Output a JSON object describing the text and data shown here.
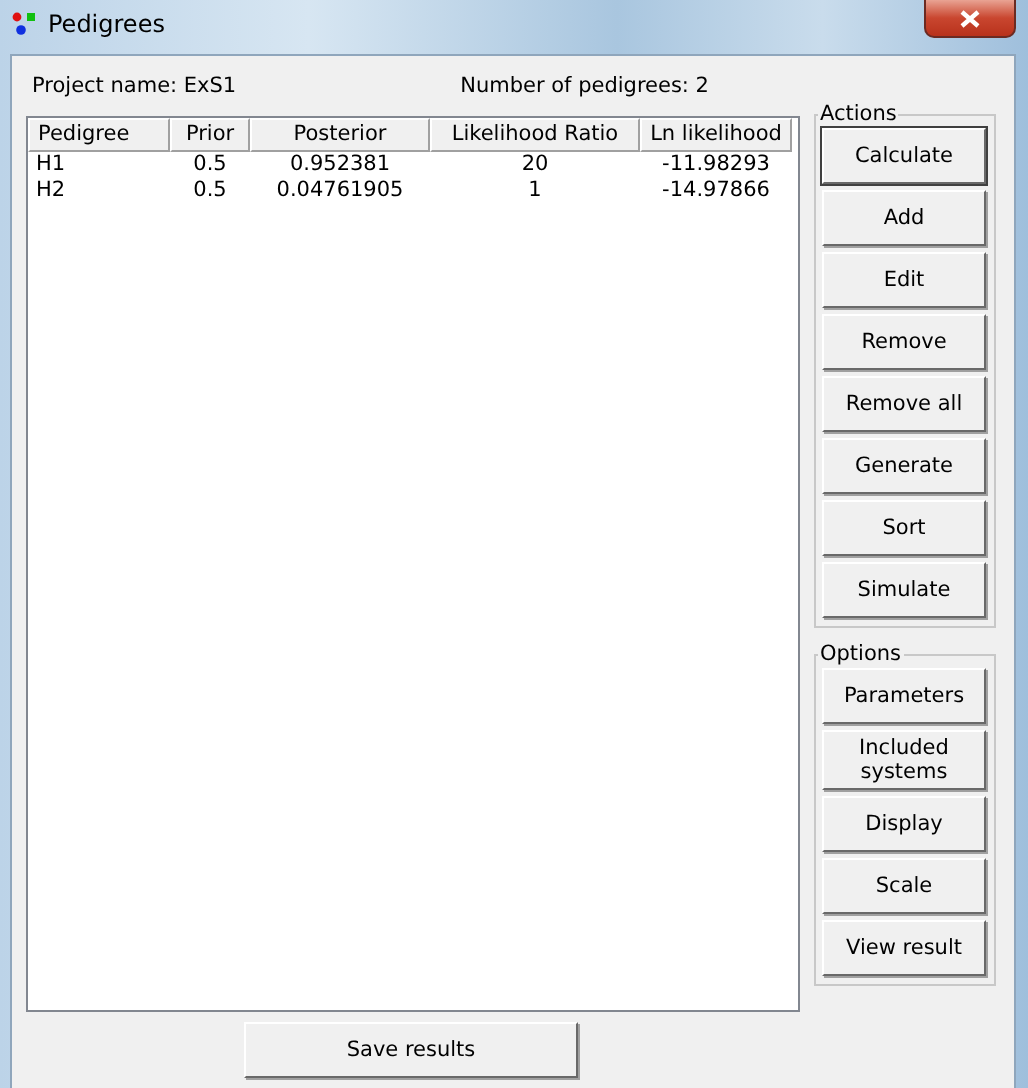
{
  "window": {
    "title": "Pedigrees"
  },
  "project_name": "Project name: ExS1",
  "pedigree_count": "Number of pedigrees: 2",
  "table": {
    "columns": [
      "Pedigree",
      "Prior",
      "Posterior",
      "Likelihood Ratio",
      "Ln likelihood"
    ],
    "rows": [
      [
        "H1",
        "0.5",
        "0.952381",
        "20",
        "-11.98293"
      ],
      [
        "H2",
        "0.5",
        "0.04761905",
        "1",
        "-14.97866"
      ]
    ]
  },
  "groups": [
    {
      "title": "Actions",
      "buttons": [
        {
          "label": "Calculate",
          "default": true
        },
        {
          "label": "Add",
          "default": false
        },
        {
          "label": "Edit",
          "default": false
        },
        {
          "label": "Remove",
          "default": false
        },
        {
          "label": "Remove all",
          "default": false
        },
        {
          "label": "Generate",
          "default": false
        },
        {
          "label": "Sort",
          "default": false
        },
        {
          "label": "Simulate",
          "default": false
        }
      ]
    },
    {
      "title": "Options",
      "buttons": [
        {
          "label": "Parameters",
          "default": false
        },
        {
          "label": "Included systems",
          "default": false
        },
        {
          "label": "Display",
          "default": false
        },
        {
          "label": "Scale",
          "default": false
        },
        {
          "label": "View result",
          "default": false
        }
      ]
    }
  ],
  "save_button": "Save results"
}
